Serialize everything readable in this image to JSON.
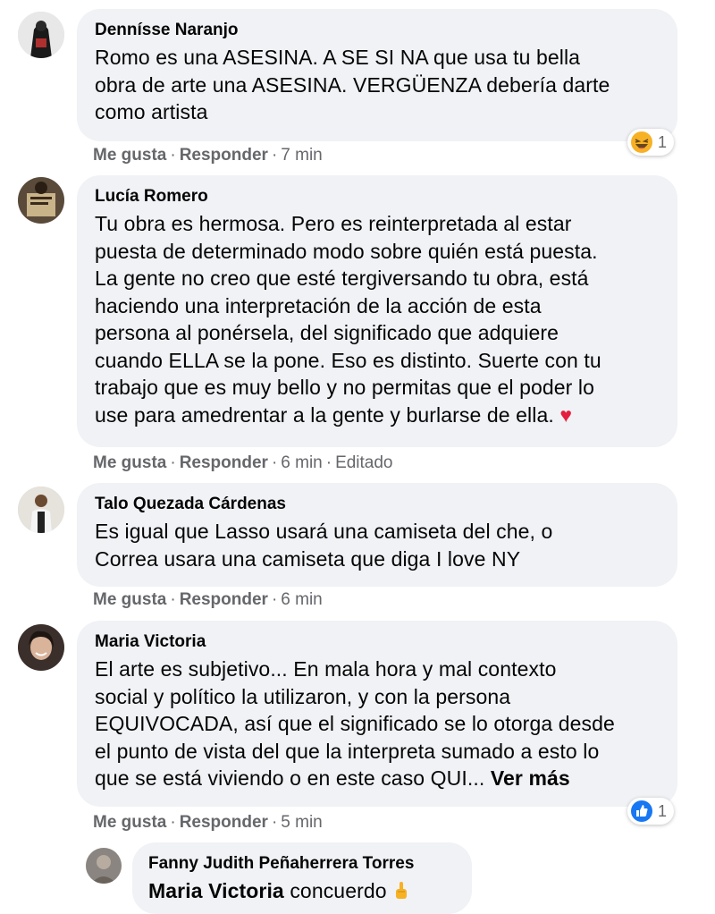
{
  "comments": [
    {
      "author": "Dennísse Naranjo",
      "text": "Romo es una ASESINA. A SE SI NA que usa tu bella\nobra de arte una ASESINA. VERGÜENZA debería darte\ncomo artista",
      "like": "Me gusta",
      "reply": "Responder",
      "time": "7 min",
      "reaction_count": "1",
      "reaction_icon": "haha-emoji-icon"
    },
    {
      "author": "Lucía Romero",
      "text": "Tu obra es hermosa. Pero es reinterpretada al estar\npuesta de determinado modo sobre quién está puesta.\nLa gente no creo que esté tergiversando tu obra, está\nhaciendo una interpretación de la acción de esta\npersona al ponérsela, del significado que adquiere\ncuando ELLA se la pone. Eso es distinto. Suerte con tu\ntrabajo que es muy bello y no permitas que el poder lo\nuse para amedrentar a la gente y burlarse de ella.",
      "emoji": "♥",
      "like": "Me gusta",
      "reply": "Responder",
      "time": "6 min",
      "edited": "Editado"
    },
    {
      "author": "Talo Quezada Cárdenas",
      "text": "Es igual que Lasso usará una camiseta del che, o\nCorrea usara una camiseta que diga I love NY",
      "like": "Me gusta",
      "reply": "Responder",
      "time": "6 min"
    },
    {
      "author": "Maria Victoria",
      "text": "El arte es subjetivo... En mala hora y mal contexto\nsocial y político la utilizaron, y con la persona\nEQUIVOCADA, así que el significado se lo otorga desde\nel punto de vista del que la interpreta sumado a esto lo\nque se está viviendo o en este caso QUI...",
      "see_more": "Ver más",
      "like": "Me gusta",
      "reply": "Responder",
      "time": "5 min",
      "reaction_count": "1",
      "reaction_icon": "like-thumb-icon"
    }
  ],
  "reply": {
    "author": "Fanny Judith Peñaherrera Torres",
    "mention": "Maria Victoria",
    "text": "concuerdo",
    "emoji_icon": "pointing-up-hand-icon"
  },
  "colors": {
    "bubble": "#f0f2f5",
    "meta": "#65676b",
    "like_blue": "#1877f2",
    "heart_red": "#e41e3f"
  },
  "separator": "·"
}
